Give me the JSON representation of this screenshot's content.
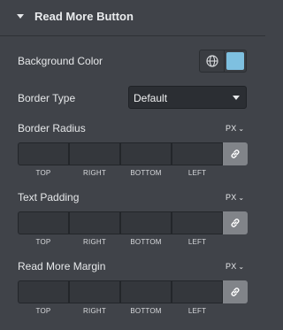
{
  "header": {
    "title": "Read More Button"
  },
  "background_color": {
    "label": "Background Color",
    "swatch": "#7ec0e0"
  },
  "border_type": {
    "label": "Border Type",
    "value": "Default"
  },
  "border_radius": {
    "label": "Border Radius",
    "unit": "PX"
  },
  "text_padding": {
    "label": "Text Padding",
    "unit": "PX"
  },
  "margin": {
    "label": "Read More Margin",
    "unit": "PX"
  },
  "dimension_captions": {
    "top": "TOP",
    "right": "RIGHT",
    "bottom": "BOTTOM",
    "left": "LEFT"
  },
  "icons": {
    "globe": "globe-icon",
    "link": "link-icon"
  }
}
